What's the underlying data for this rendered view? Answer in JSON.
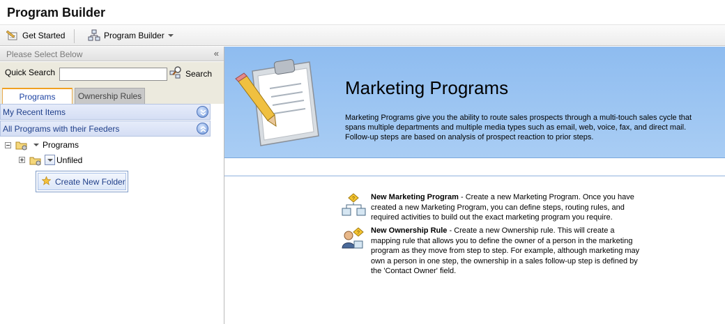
{
  "app": {
    "title": "Program Builder"
  },
  "toolbar": {
    "get_started_label": "Get Started",
    "program_builder_label": "Program Builder"
  },
  "left_panel": {
    "header_label": "Please Select Below",
    "collapse_glyph": "«",
    "quick_search": {
      "label": "Quick Search",
      "value": "",
      "button_label": "Search"
    },
    "tabs": [
      {
        "label": "Programs",
        "active": true
      },
      {
        "label": "Ownership Rules",
        "active": false
      }
    ],
    "accordions": [
      {
        "label": "My Recent Items",
        "state": "collapsed"
      },
      {
        "label": "All Programs with their Feeders",
        "state": "expanded"
      }
    ],
    "tree": {
      "root_label": "Programs",
      "child_label": "Unfiled"
    },
    "context_menu": {
      "item_label": "Create New Folder"
    }
  },
  "main": {
    "banner": {
      "heading": "Marketing Programs",
      "description": "Marketing Programs give you the ability to route sales prospects through a multi-touch sales cycle that spans multiple departments and multiple media types such as email, web, voice, fax, and direct mail. Follow-up steps are based on analysis of prospect reaction to prior steps."
    },
    "actions": [
      {
        "title": "New Marketing Program",
        "text": " - Create a new Marketing Program. Once you have created a new Marketing Program, you can define steps, routing rules, and required activities to build out the exact marketing program you require."
      },
      {
        "title": "New Ownership Rule",
        "text": " - Create a new Ownership rule. This will create a mapping rule that allows you to define the owner of a person in the marketing program as they move from step to step. For example, although marketing may own a person in one step, the ownership in a sales follow-up step is defined by the 'Contact Owner' field."
      }
    ]
  },
  "colors": {
    "banner_blue": "#9cc5f2",
    "accent_orange": "#f0a020",
    "link_blue": "#1f3f8a"
  }
}
